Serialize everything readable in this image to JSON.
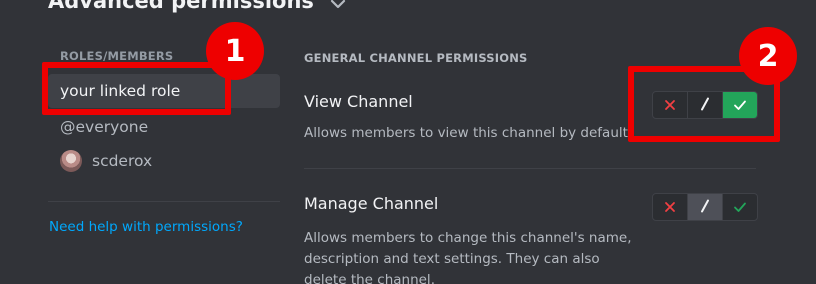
{
  "header": {
    "title": "Advanced permissions"
  },
  "roles": {
    "heading": "ROLES/MEMBERS",
    "items": [
      {
        "label": "your linked role",
        "selected": true
      },
      {
        "label": "@everyone",
        "selected": false
      },
      {
        "label": "scderox",
        "selected": false,
        "has_avatar": true
      }
    ],
    "help_link": "Need help with permissions?"
  },
  "permissions": {
    "section_heading": "GENERAL CHANNEL PERMISSIONS",
    "items": [
      {
        "title": "View Channel",
        "description": "Allows members to view this channel by default.",
        "state": "allow"
      },
      {
        "title": "Manage Channel",
        "description": "Allows members to change this channel's name, description and text settings. They can also delete the channel.",
        "state": "neutral"
      }
    ]
  },
  "annotations": {
    "badge_1": "1",
    "badge_2": "2",
    "color": "#ee0000"
  },
  "colors": {
    "background": "#313338",
    "allow_green": "#23a55a",
    "deny_red": "#f23f43",
    "link_blue": "#00a8fc"
  },
  "icons": {
    "deny": "x-icon",
    "neutral": "slash-icon",
    "allow": "check-icon",
    "header_toggle": "chevron-down-icon"
  }
}
